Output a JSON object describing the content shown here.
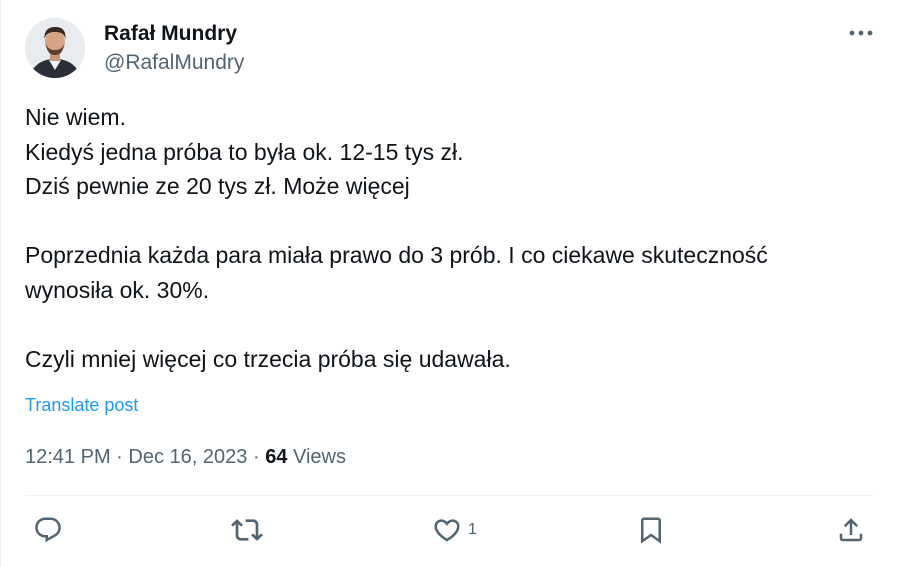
{
  "author": {
    "display_name": "Rafał Mundry",
    "handle": "@RafalMundry"
  },
  "post": {
    "lines": [
      "Nie wiem.",
      "Kiedyś jedna próba to była ok. 12-15 tys zł.",
      "Dziś pewnie ze 20 tys zł. Może więcej",
      "",
      "Poprzednia każda para miała prawo do 3 prób. I co ciekawe skuteczność",
      "wynosiła ok. 30%.",
      "",
      "Czyli mniej więcej co trzecia próba się udawała."
    ],
    "translate_label": "Translate post"
  },
  "meta": {
    "time": "12:41 PM",
    "separator": "·",
    "date": "Dec 16, 2023",
    "views_count": "64",
    "views_label": "Views"
  },
  "actions": {
    "reply_icon": "reply-icon",
    "repost_icon": "repost-icon",
    "like_icon": "heart-icon",
    "like_count": "1",
    "bookmark_icon": "bookmark-icon",
    "share_icon": "share-icon"
  },
  "colors": {
    "text_primary": "#0f1419",
    "text_secondary": "#536471",
    "link": "#1d9bf0",
    "divider": "#eff3f4"
  }
}
